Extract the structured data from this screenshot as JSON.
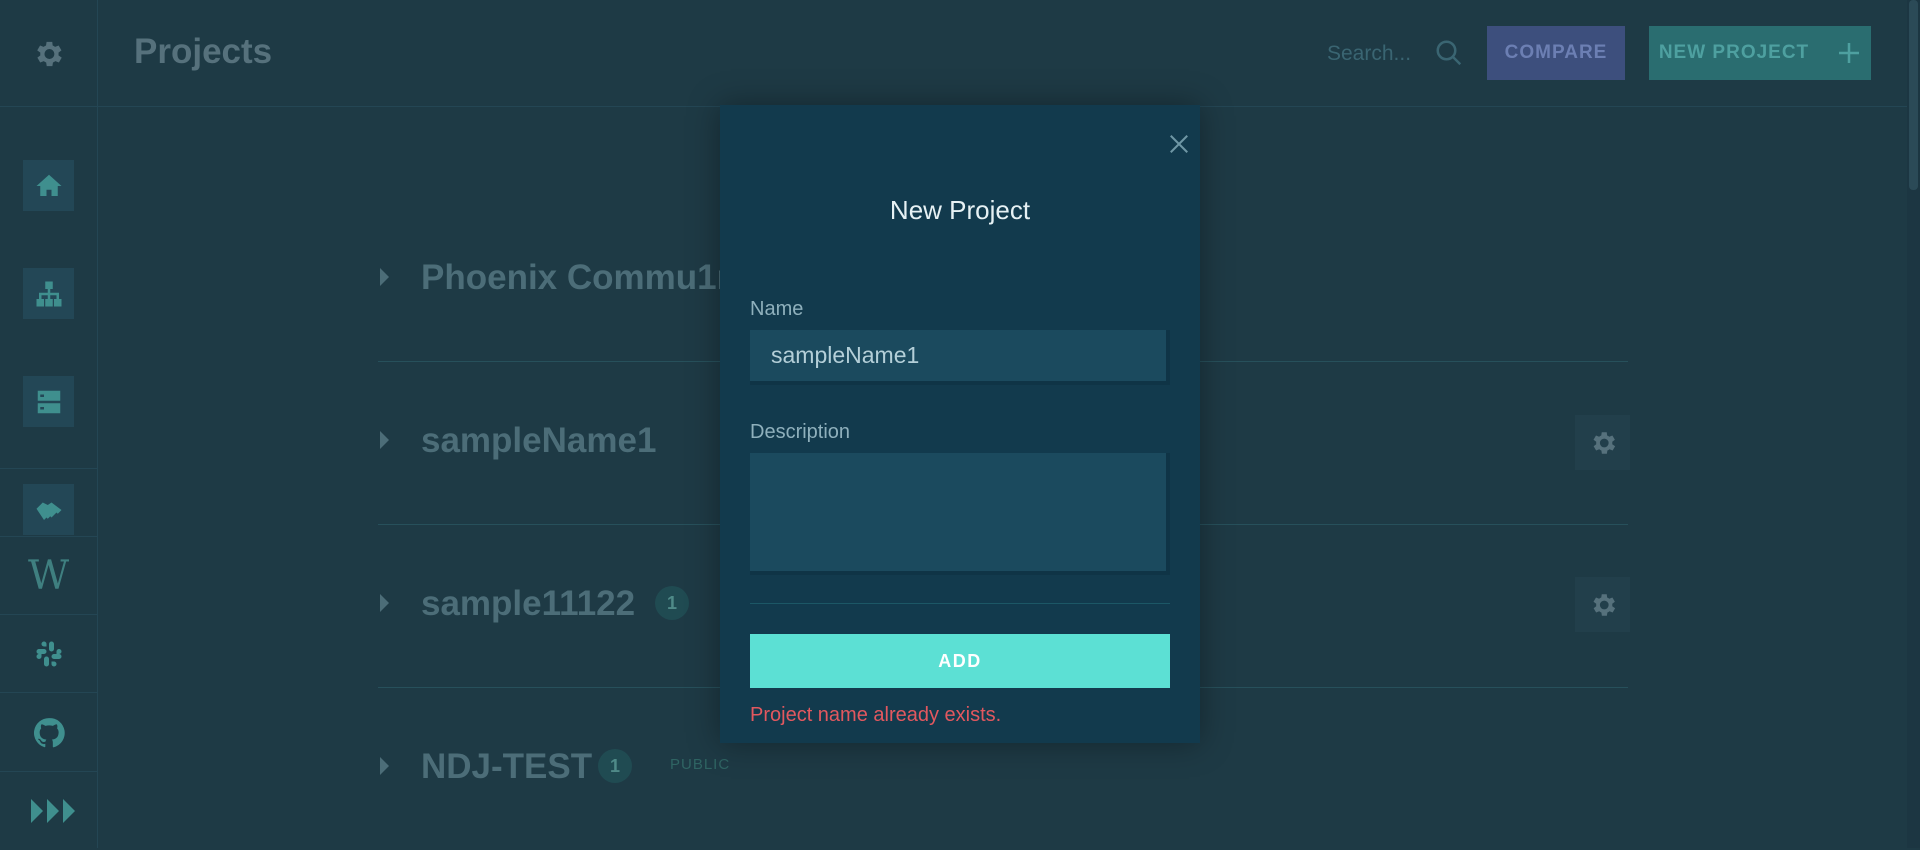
{
  "header": {
    "title": "Projects",
    "search_placeholder": "Search...",
    "compare_label": "COMPARE",
    "new_project_label": "NEW PROJECT",
    "new_project_icon": "plus-icon"
  },
  "sidebar": {
    "items": [
      {
        "name": "settings",
        "icon": "gear-icon"
      },
      {
        "name": "home",
        "icon": "home-icon"
      },
      {
        "name": "hierarchy",
        "icon": "sitemap-icon"
      },
      {
        "name": "servers",
        "icon": "server-icon"
      },
      {
        "name": "handshake",
        "icon": "handshake-icon"
      },
      {
        "name": "wiki",
        "icon": "wikipedia-icon",
        "text": "W"
      },
      {
        "name": "slack",
        "icon": "slack-icon"
      },
      {
        "name": "github",
        "icon": "github-icon"
      },
      {
        "name": "expand",
        "icon": "fast-forward-icon"
      }
    ]
  },
  "projects": [
    {
      "name": "Phoenix Commu1r"
    },
    {
      "name": "sampleName1"
    },
    {
      "name": "sample11122",
      "count": "1"
    },
    {
      "name": "NDJ-TEST",
      "count": "1",
      "tag": "PUBLIC"
    }
  ],
  "modal": {
    "title": "New Project",
    "name_label": "Name",
    "name_value": "sampleName1",
    "description_label": "Description",
    "description_value": "",
    "add_label": "ADD",
    "error": "Project name already exists."
  },
  "colors": {
    "background": "#1e3a45",
    "modal": "#123a4d",
    "accent": "#5ce0d4",
    "error": "#e2585f"
  }
}
